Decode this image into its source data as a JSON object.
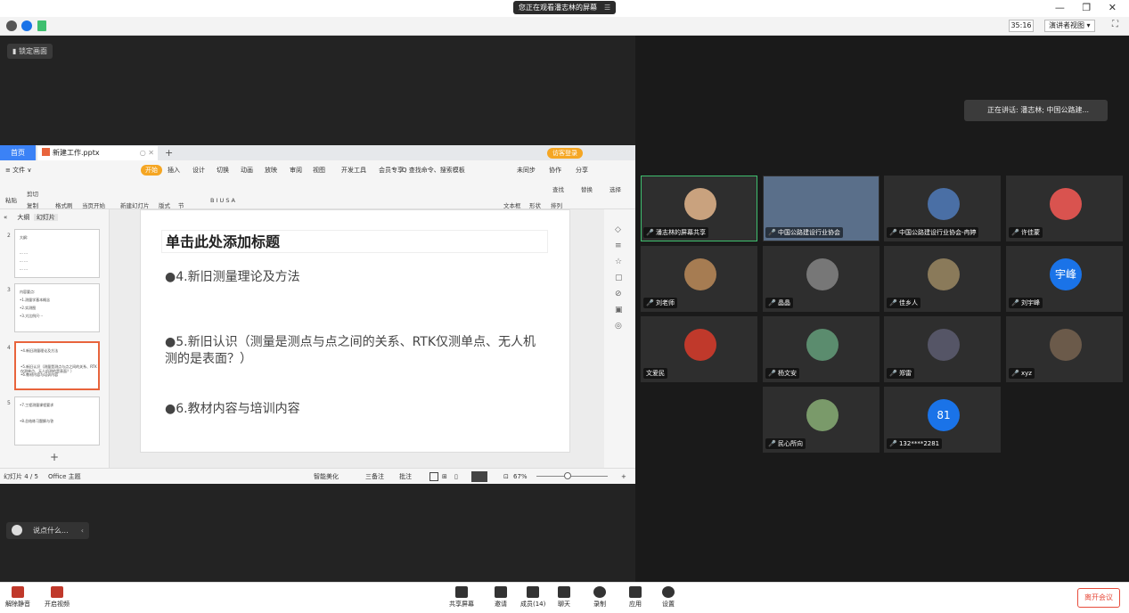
{
  "window": {
    "share_banner": "您正在观看潘志林的屏幕",
    "banner_menu": "☰",
    "controls": "— ❐ ✕"
  },
  "infobar": {
    "timer": "35:16",
    "presenter_view": "演讲者视图 ▾",
    "fullscreen": "⛶"
  },
  "stage": {
    "lock_label": "锁定画面"
  },
  "speaking": "正在讲话: 潘志林; 中国公路建...",
  "participants": [
    {
      "name": "潘志林的屏幕共享",
      "avatar": "photo",
      "mic": "on",
      "active": true
    },
    {
      "name": "中国公路建设行业协会",
      "avatar": "photo",
      "mic": "on"
    },
    {
      "name": "中国公路建设行业协会-冉婷",
      "avatar": "photo",
      "mic": "off"
    },
    {
      "name": "许佳蒙",
      "avatar": "photo",
      "mic": "off"
    },
    {
      "name": "刘老师",
      "avatar": "photo",
      "mic": "on"
    },
    {
      "name": "晶晶",
      "avatar": "photo",
      "mic": "on"
    },
    {
      "name": "佳乡人",
      "avatar": "photo",
      "mic": "on"
    },
    {
      "name": "刘宇峰",
      "avatar": "宇峰",
      "mic": "on"
    },
    {
      "name": "文爱民",
      "avatar": "photo",
      "mic": "none"
    },
    {
      "name": "杨文安",
      "avatar": "photo",
      "mic": "on"
    },
    {
      "name": "郑雷",
      "avatar": "photo",
      "mic": "off"
    },
    {
      "name": "xyz",
      "avatar": "photo",
      "mic": "off"
    },
    {
      "name": "民心所向",
      "avatar": "photo",
      "mic": "off"
    },
    {
      "name": "132****2281",
      "avatar": "81",
      "mic": "off"
    }
  ],
  "wps": {
    "home_tab": "首页",
    "doc_tab": "新建工作.pptx",
    "login": "访客登录",
    "menu": [
      "≡ 文件 ∨",
      "开始",
      "插入",
      "设计",
      "切换",
      "动画",
      "放映",
      "审阅",
      "视图",
      "开发工具",
      "会员专享",
      "Q 查找命令、搜索模板",
      "未同步",
      "协作",
      "分享"
    ],
    "ribbon": [
      "粘贴",
      "剪切",
      "复制",
      "格式刷",
      "当页开始",
      "新建幻灯片",
      "版式",
      "节",
      "B I U S A",
      "文本框",
      "形状",
      "排列",
      "查找",
      "替换",
      "选择"
    ],
    "view_tabs": [
      "大纲",
      "幻灯片"
    ],
    "thumbs": [
      {
        "no": "2",
        "lines": [
          "大纲:",
          "",
          "··· ···",
          "··· ···",
          "··· ···"
        ]
      },
      {
        "no": "3",
        "lines": [
          "内容要点:",
          "•1.测量学基本概念",
          "•2.实测图",
          "•3.大比例尺···"
        ]
      },
      {
        "no": "4",
        "lines": [
          "•4.新旧测量理论及方法",
          "",
          "•5.新旧认识（测量是测点与点之间的关系、RTK仅测单点、无人机测的是表面？）",
          "•6.教材内容与培训内容"
        ]
      },
      {
        "no": "5",
        "lines": [
          "•7.工程测量课程要求",
          "",
          "•8.总结练习题解与答"
        ]
      }
    ],
    "add_slide": "+",
    "slide": {
      "title": "单击此处添加标题",
      "bullets": [
        "●4.新旧测量理论及方法",
        "●5.新旧认识（测量是测点与点之间的关系、RTK仅测单点、无人机测的是表面？）",
        "●6.教材内容与培训内容"
      ]
    },
    "status": {
      "slide": "幻灯片 4 / 5",
      "theme": "Office 主题",
      "smart": "智能美化",
      "notes": "三备注",
      "comment": "批注",
      "zoom": "67%"
    }
  },
  "chat": {
    "placeholder": "说点什么...",
    "chev": "‹"
  },
  "toolbar": {
    "left": [
      {
        "label": "解除静音"
      },
      {
        "label": "开启视频"
      }
    ],
    "center": [
      {
        "label": "共享屏幕"
      },
      {
        "label": "邀请"
      },
      {
        "label": "成员(14)"
      },
      {
        "label": "聊天"
      },
      {
        "label": "录制"
      },
      {
        "label": "应用"
      },
      {
        "label": "设置"
      }
    ],
    "leave": "离开会议"
  }
}
